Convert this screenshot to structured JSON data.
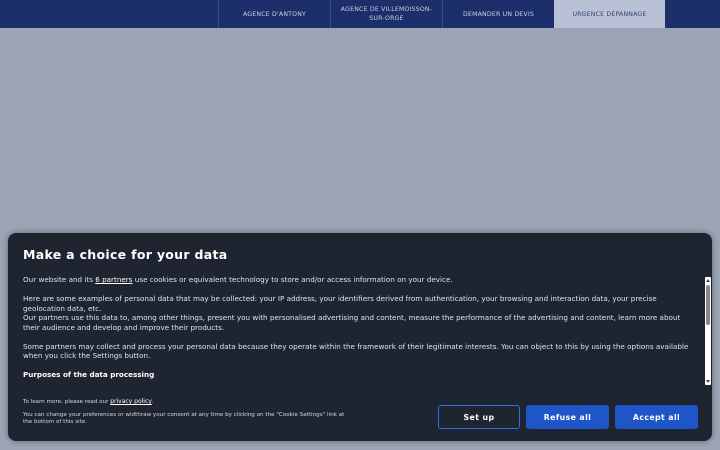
{
  "nav": {
    "items": [
      {
        "label": "AGENCE D'ANTONY"
      },
      {
        "label": "AGENCE DE VILLEMOISSON-SUR-ORGE"
      },
      {
        "label": "DEMANDER UN DEVIS"
      },
      {
        "label": "URGENCE DÉPANNAGE"
      }
    ]
  },
  "consent": {
    "title": "Make a choice for your data",
    "p1_prefix": "Our website and its ",
    "p1_link": "6 partners",
    "p1_suffix": " use cookies or equivalent technology to store and/or access information on your device.",
    "p2": "Here are some examples of personal data that may be collected: your IP address, your identifiers derived from authentication, your browsing and interaction data, your precise geolocation data, etc.",
    "p3": "Our partners use this data to, among other things, present you with personalised advertising and content, measure the performance of the advertising and content, learn more about their audience and develop and improve their products.",
    "p4": "Some partners may collect and process your personal data because they operate within the framework of their legitimate interests. You can object to this by using the options available when you click the Settings button.",
    "section_title": "Purposes of the data processing",
    "footer_prefix": "To learn more, please read our ",
    "footer_link": "privacy policy",
    "footer_suffix": ".",
    "footer_line2": "You can change your preferences or widthraw your consent at any time by clicking on the \"Cookie Settings\" link at the bottom of this site.",
    "buttons": {
      "setup": "Set up",
      "refuse": "Refuse all",
      "accept": "Accept all"
    }
  },
  "colors": {
    "nav_bg": "#1d2f6b",
    "page_bg": "#9aa4b4",
    "dialog_bg": "#1e2530",
    "button_blue": "#1e56c8"
  }
}
